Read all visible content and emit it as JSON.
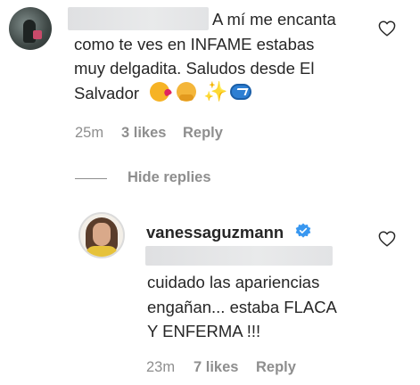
{
  "comment": {
    "lines": [
      "A mí me encanta",
      "como te ves en INFAME estabas",
      "muy delgadita. Saludos desde El",
      "Salvador"
    ],
    "emojis": [
      "face-blowing-kiss-emoji",
      "hugging-face-emoji",
      "sparkles-emoji",
      "arrows-cycle-emoji"
    ],
    "time": "25m",
    "likes": "3 likes",
    "reply_label": "Reply"
  },
  "hide_replies_label": "Hide replies",
  "reply": {
    "username": "vanessaguzmann",
    "verified": true,
    "lines": [
      "cuidado las apariencias",
      "engañan... estaba FLACA",
      "Y ENFERMA !!!"
    ],
    "time": "23m",
    "likes": "7 likes",
    "reply_label": "Reply"
  },
  "icons": {
    "like": "heart-outline-icon",
    "verified": "verified-badge-icon"
  },
  "colors": {
    "text": "#262626",
    "secondary": "#8e8e8e",
    "verified": "#3897f0"
  }
}
